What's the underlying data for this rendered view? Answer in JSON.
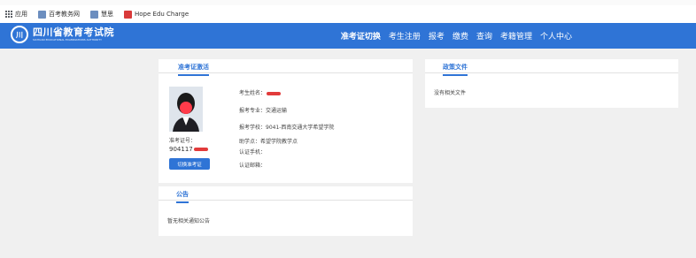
{
  "bookmarks": [
    {
      "label": "应用",
      "icon": "apps-grid-icon"
    },
    {
      "label": "百考教务网",
      "icon": "bookmark-page-icon"
    },
    {
      "label": "慧思",
      "icon": "bookmark-page-icon"
    },
    {
      "label": "Hope Edu Charge",
      "icon": "bookmark-red-icon"
    }
  ],
  "header": {
    "logo_cn": "四川省教育考试院",
    "logo_en": "SICHUAN EDUCATIONAL EXAMINATIONS AUTHORITY",
    "nav": [
      "准考证切换",
      "考生注册",
      "报考",
      "缴费",
      "查询",
      "考籍管理",
      "个人中心"
    ],
    "active_nav": "准考证切换"
  },
  "card": {
    "title": "准考证激活",
    "name_label": "考生姓名：",
    "major_label": "报考专业：交通运输",
    "school_label": "报考学校：9041-西南交通大学希望学院",
    "assist_label": "助学点：希望学院教学点",
    "phone_label": "认证手机：",
    "email_label": "认证邮箱：",
    "ticket_label": "准考证号：",
    "ticket_prefix": "904117",
    "switch_button": "切换准考证"
  },
  "notice": {
    "title": "公告",
    "empty_text": "暂无相关通知公告"
  },
  "policy": {
    "title": "政策文件",
    "empty_text": "没有相关文件"
  },
  "colors": {
    "brand_blue": "#2f74d6",
    "redaction": "#e23b3b"
  }
}
